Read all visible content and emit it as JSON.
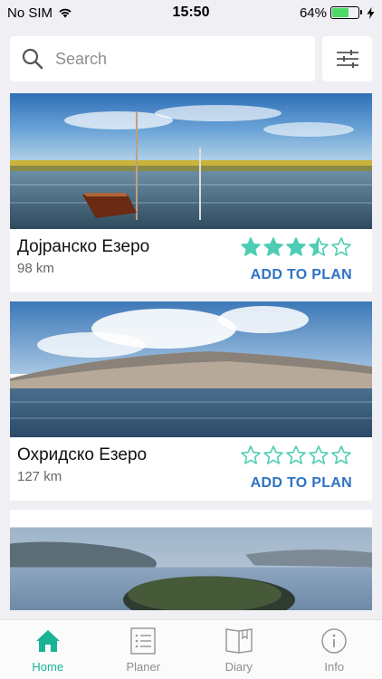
{
  "status_bar": {
    "carrier": "No SIM",
    "time": "15:50",
    "battery": "64%",
    "battery_level": 0.64
  },
  "search": {
    "placeholder": "Search",
    "value": ""
  },
  "places": [
    {
      "title": "Дојранско Езеро",
      "distance": "98 km",
      "rating": 3.5,
      "action": "ADD TO PLAN"
    },
    {
      "title": "Охридско Езеро",
      "distance": "127 km",
      "rating": 0,
      "action": "ADD TO PLAN"
    }
  ],
  "tabs": [
    {
      "label": "Home",
      "icon": "home-icon"
    },
    {
      "label": "Planer",
      "icon": "list-icon"
    },
    {
      "label": "Diary",
      "icon": "book-icon"
    },
    {
      "label": "Info",
      "icon": "info-icon"
    }
  ],
  "colors": {
    "accent": "#1ab394",
    "star": "#4ecdb4",
    "link": "#2e73c4",
    "battery": "#4cd964"
  }
}
